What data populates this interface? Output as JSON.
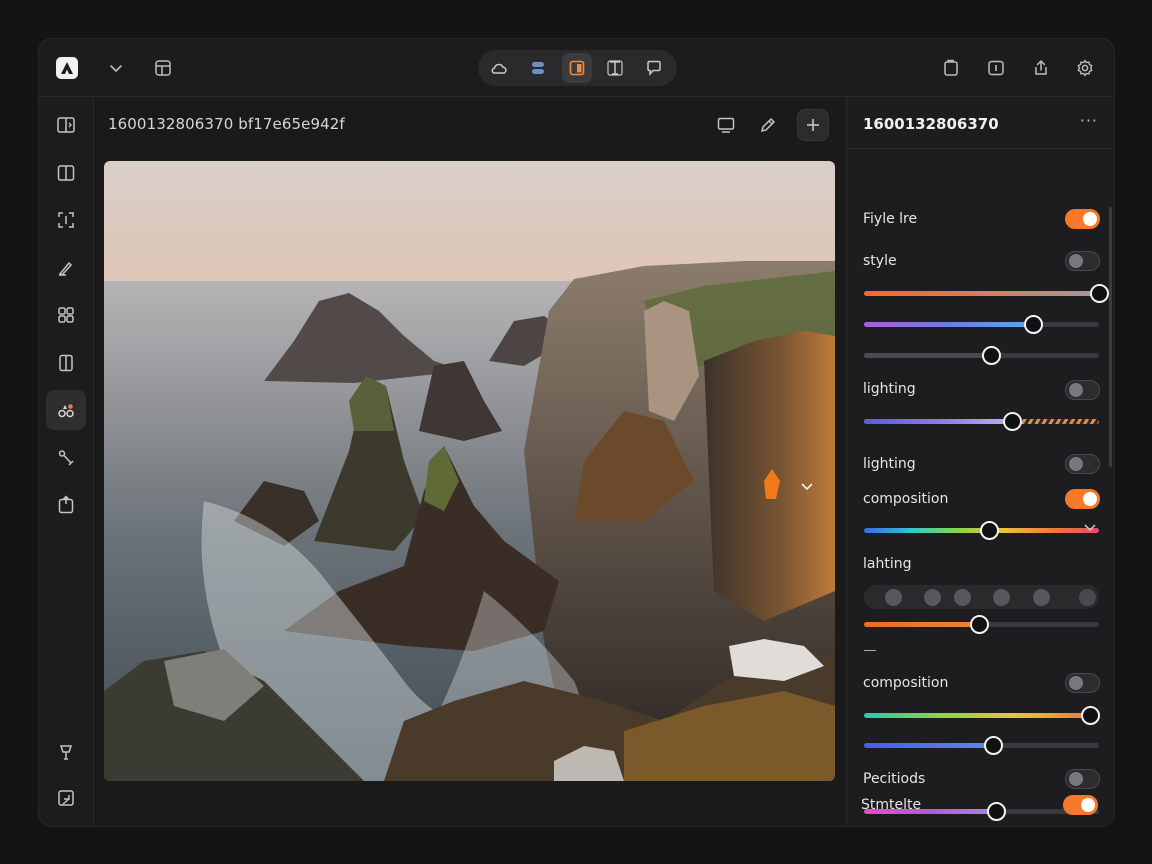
{
  "document": {
    "title": "1600132806370 bf17e65e942f"
  },
  "panel": {
    "title": "1600132806370",
    "more_label": "···",
    "rows": [
      {
        "label": "Fiyle lre",
        "toggle": true
      },
      {
        "label": "style",
        "toggle": false
      },
      {
        "label": "lighting",
        "toggle": false
      },
      {
        "label": "lighting",
        "toggle": false
      },
      {
        "label": "composition",
        "toggle": true
      },
      {
        "label": "lahting",
        "expandable": true
      },
      {
        "label": "composition",
        "toggle": false
      },
      {
        "label": "Pecitiods",
        "toggle": false
      },
      {
        "label": "Stmtelte",
        "toggle": true
      }
    ],
    "sliders": [
      {
        "value": 1.0,
        "gradient": "orange-gray"
      },
      {
        "value": 0.72,
        "gradient": "purple-blue"
      },
      {
        "value": 0.54,
        "gradient": "neutral"
      },
      {
        "value": 0.63,
        "gradient": "violet-striped"
      },
      {
        "value": 0.53,
        "gradient": "rainbow"
      },
      {
        "value": 0.49,
        "gradient": "orange"
      },
      {
        "value": 0.96,
        "gradient": "teal-orange"
      },
      {
        "value": 0.55,
        "gradient": "blue"
      },
      {
        "value": 0.56,
        "gradient": "pink-purple"
      }
    ]
  },
  "colors": {
    "accent": "#f47a2a",
    "background": "#1c1c1d",
    "panel": "#1d1d1f"
  },
  "icons": {
    "topbar": [
      "app-logo-icon",
      "chevron-down-icon",
      "layout-icon",
      "cloud-icon",
      "layers-icon",
      "frame-icon",
      "text-icon",
      "comment-icon",
      "page-icon",
      "info-icon",
      "share-icon",
      "settings-icon"
    ],
    "rail": [
      "compare-icon",
      "split-icon",
      "crop-icon",
      "brush-icon",
      "components-icon",
      "columns-icon",
      "shapes-icon",
      "pen-tool-icon",
      "export-icon",
      "paint-icon",
      "feedback-icon"
    ]
  }
}
